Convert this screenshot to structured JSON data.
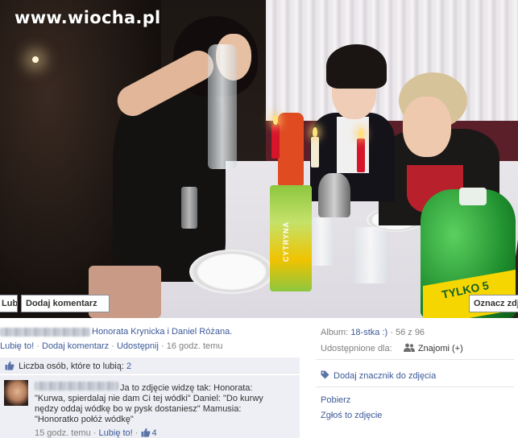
{
  "photo": {
    "watermark": "www.wiocha.pl",
    "bottle_label_green": "TYLKO 5",
    "juice_label": "CYTRYNA",
    "overlay_like": "Lubię to!",
    "overlay_comment": "Dodaj komentarz",
    "overlay_tag": "Oznacz zdjęcie"
  },
  "caption": {
    "tagged": "Honorata Krynicka i Daniel Różana."
  },
  "actions": {
    "like": "Lubię to!",
    "comment": "Dodaj komentarz",
    "share": "Udostępnij",
    "sep": "·",
    "time": "16 godz. temu"
  },
  "likes": {
    "label": "Liczba osób, które to lubią:",
    "count": "2"
  },
  "comment": {
    "text": "Ja to zdjęcie widzę tak: Honorata: \"Kurwa, spierdalaj nie dam Ci tej wódki\" Daniel: \"Do kurwy nędzy oddaj wódkę bo w pysk dostaniesz\" Mamusia: \"Honoratko połóż wódkę\"",
    "time": "15 godz. temu",
    "like": "Lubię to!",
    "like_count": "4"
  },
  "sidebar": {
    "album_label": "Album:",
    "album_name": "18-stka :)",
    "album_position": "56 z 96",
    "shared_label": "Udostępnione dla:",
    "shared_value": "Znajomi (+)",
    "add_tag": "Dodaj znacznik do zdjęcia",
    "download": "Pobierz",
    "report": "Zgłoś to zdjęcie"
  },
  "colors": {
    "link": "#3b5998",
    "panel_bg": "#edeff4",
    "muted": "#7f7f7f"
  }
}
